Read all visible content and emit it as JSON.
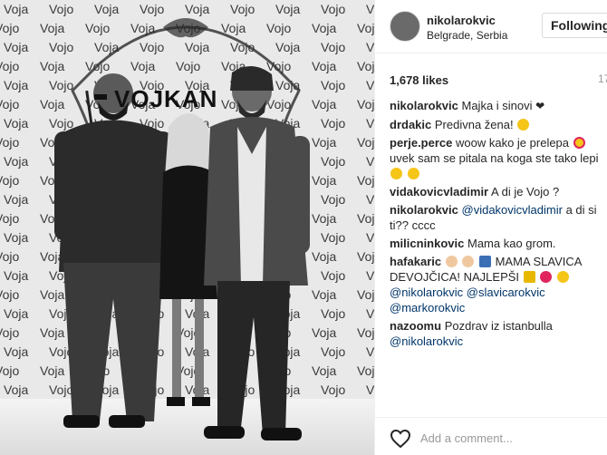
{
  "post": {
    "username": "nikolarokvic",
    "location": "Belgrade, Serbia",
    "follow_label": "Following",
    "likes": "1,678 likes",
    "age": "17",
    "add_comment_placeholder": "Add a comment..."
  },
  "photo": {
    "wall_words": [
      "Voja",
      "Vojo",
      "Vojkan"
    ],
    "sign": "VOJKAN",
    "alt": "Black and white photo of a woman with two men in front of a branded backdrop"
  },
  "comments": [
    {
      "user": "nikolarokvic",
      "text": "Majka i sinovi"
    },
    {
      "user": "drdakic",
      "text": "Predivna žena!"
    },
    {
      "user": "perje.perce",
      "text": "woow kako je prelepa",
      "text2": "uvek sam se pitala na koga ste tako lepi"
    },
    {
      "user": "vidakovicvladimir",
      "text": "A di je Vojo ?"
    },
    {
      "user": "nikolarokvic",
      "mention": "@vidakovicvladimir",
      "text": "a di si ti?? cccc"
    },
    {
      "user": "milicninkovic",
      "text": "Mama kao grom."
    },
    {
      "user": "hafakaric",
      "text": "MAMA SLAVICA DEVOJČICA! NAJLEPŠI",
      "mention": "@nikolarokvic",
      "mention2": "@slavicarokvic",
      "mention3": "@markorokvic"
    },
    {
      "user": "nazoomu",
      "text": "Pozdrav iz istanbulla",
      "mention": "@nikolarokvic"
    }
  ],
  "colors": {
    "mention": "#003569",
    "like_heart": "#262626"
  }
}
